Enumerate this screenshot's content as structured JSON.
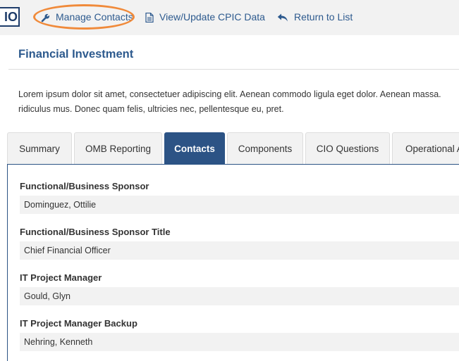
{
  "toolbar": {
    "logo_text": "IO",
    "manage_contacts": "Manage Contacts",
    "view_update_cpic": "View/Update CPIC Data",
    "return_to_list": "Return to List"
  },
  "page": {
    "title": "Financial Investment",
    "description_line1": "Lorem ipsum dolor sit amet, consectetuer adipiscing elit. Aenean commodo ligula eget dolor. Aenean massa.",
    "description_line2": "ridiculus mus. Donec quam felis, ultricies nec, pellentesque eu, pret."
  },
  "tabs": [
    {
      "label": "Summary",
      "active": false
    },
    {
      "label": "OMB Reporting",
      "active": false
    },
    {
      "label": "Contacts",
      "active": true
    },
    {
      "label": "Components",
      "active": false
    },
    {
      "label": "CIO Questions",
      "active": false
    },
    {
      "label": "Operational A",
      "active": false
    }
  ],
  "fields": [
    {
      "label": "Functional/Business Sponsor",
      "value": "Dominguez, Ottilie"
    },
    {
      "label": "Functional/Business Sponsor Title",
      "value": "Chief Financial Officer"
    },
    {
      "label": "IT Project Manager",
      "value": "Gould, Glyn"
    },
    {
      "label": "IT Project Manager Backup",
      "value": "Nehring, Kenneth"
    }
  ],
  "colors": {
    "accent": "#2c5385",
    "link": "#2d5a8e",
    "highlight": "#f08a3a"
  },
  "icons": {
    "manage_contacts": "wrench-icon",
    "view_update_cpic": "document-icon",
    "return_to_list": "return-arrow-icon"
  }
}
